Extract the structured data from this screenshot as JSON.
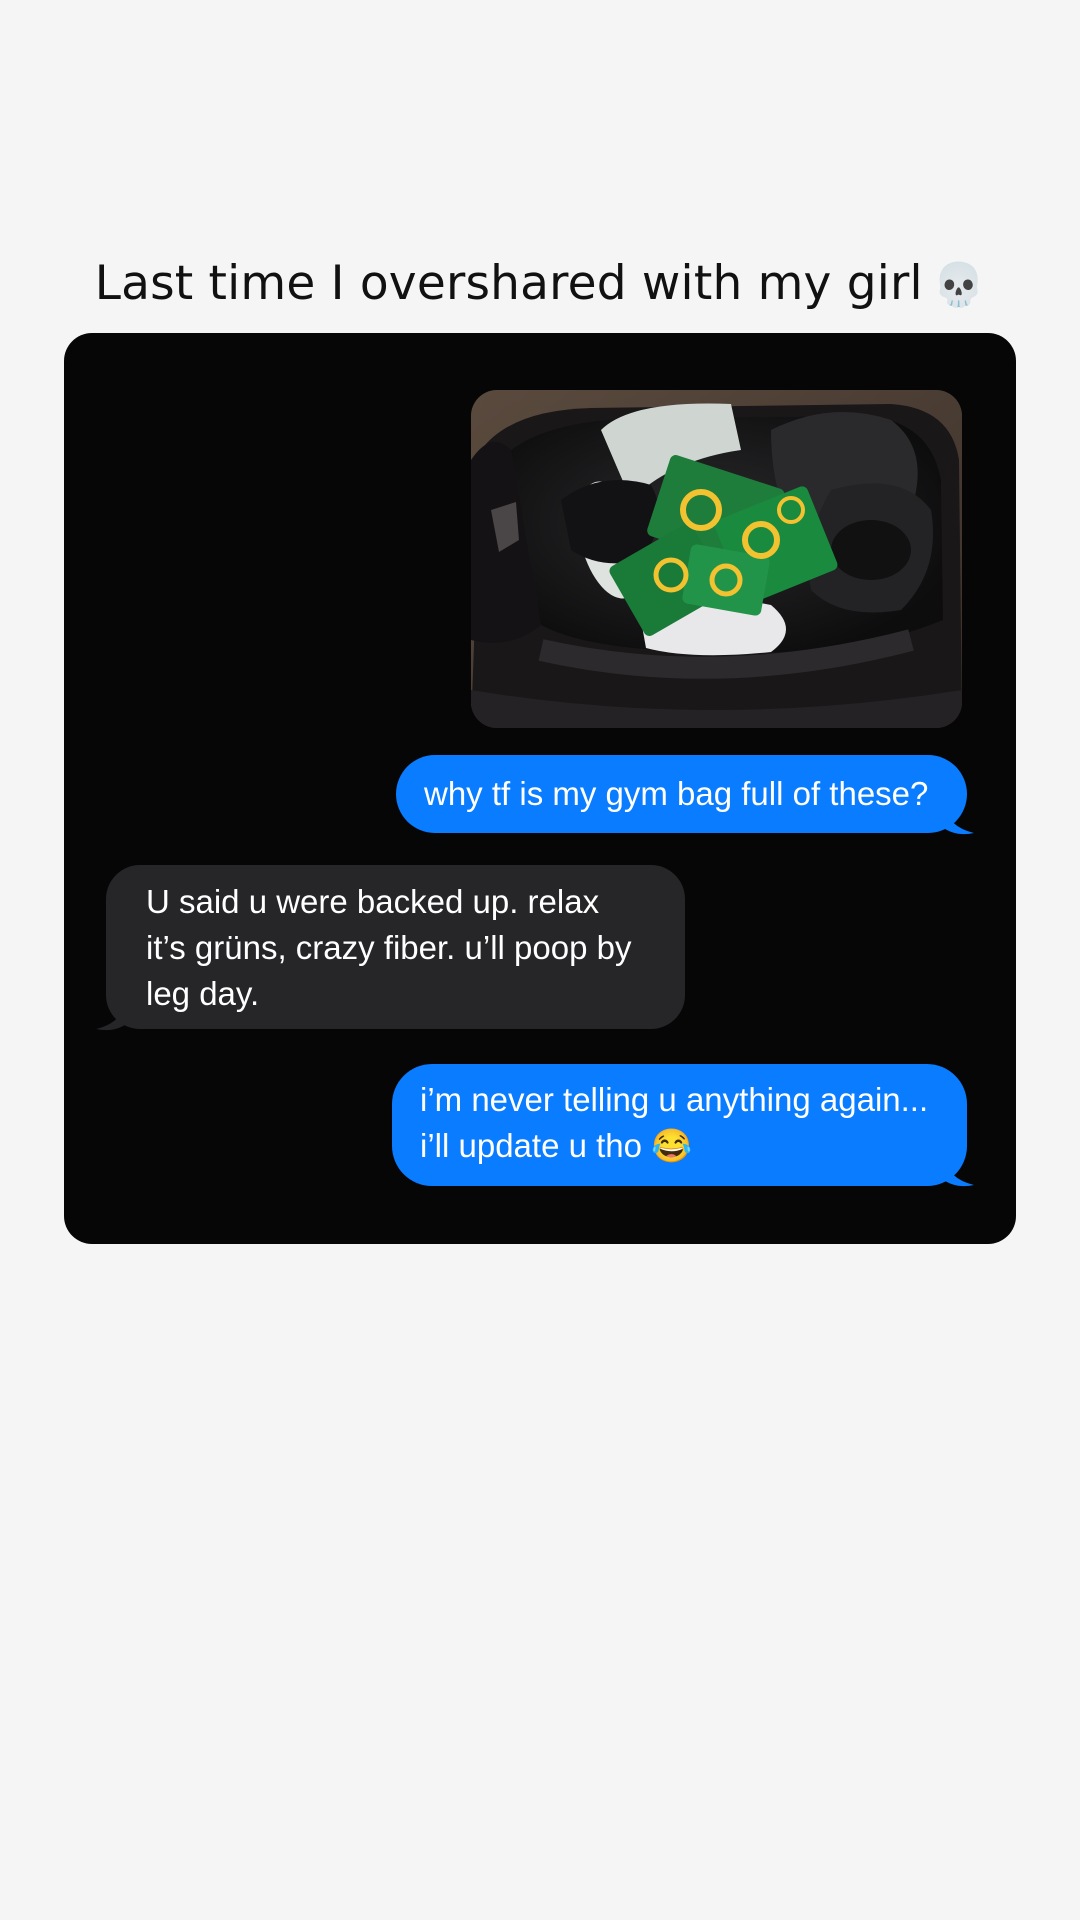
{
  "caption": {
    "text": "Last time I overshared with my girl",
    "emoji": "💀"
  },
  "conversation": {
    "photo": {
      "icon": "gym-bag-photo",
      "description_label": "photo"
    },
    "messages": [
      {
        "direction": "sent",
        "text": "why tf is my gym bag full of these?"
      },
      {
        "direction": "received",
        "text": "U said u were backed up. relax it’s grüns,  crazy fiber. u’ll poop by leg day."
      },
      {
        "direction": "sent",
        "text": "i’m never telling u anything again... i’ll update u tho 😂"
      }
    ]
  },
  "colors": {
    "page_background": "#f5f5f5",
    "chat_background": "#060606",
    "sent_bubble": "#0a7cff",
    "received_bubble": "#262629",
    "message_text": "#ffffff"
  }
}
